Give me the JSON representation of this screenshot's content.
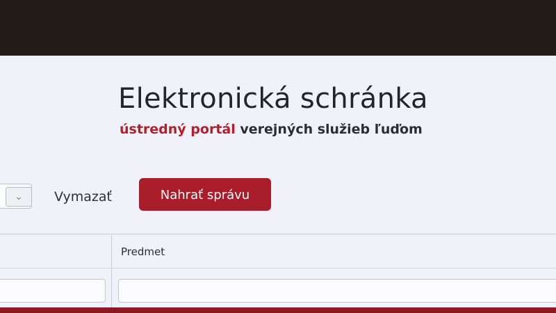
{
  "header": {
    "title": "Elektronická schránka",
    "subtitle_accent": "ústredný portál",
    "subtitle_rest": "verejných služieb ľuďom"
  },
  "toolbar": {
    "dropdown_icon": "chevron-down-icon",
    "clear_label": "Vymazať",
    "upload_label": "Nahrať správu"
  },
  "table": {
    "columns": [
      "",
      "Predmet"
    ]
  },
  "colors": {
    "accent": "#a91d2a",
    "text": "#23252d",
    "background": "#f1f2f9"
  }
}
